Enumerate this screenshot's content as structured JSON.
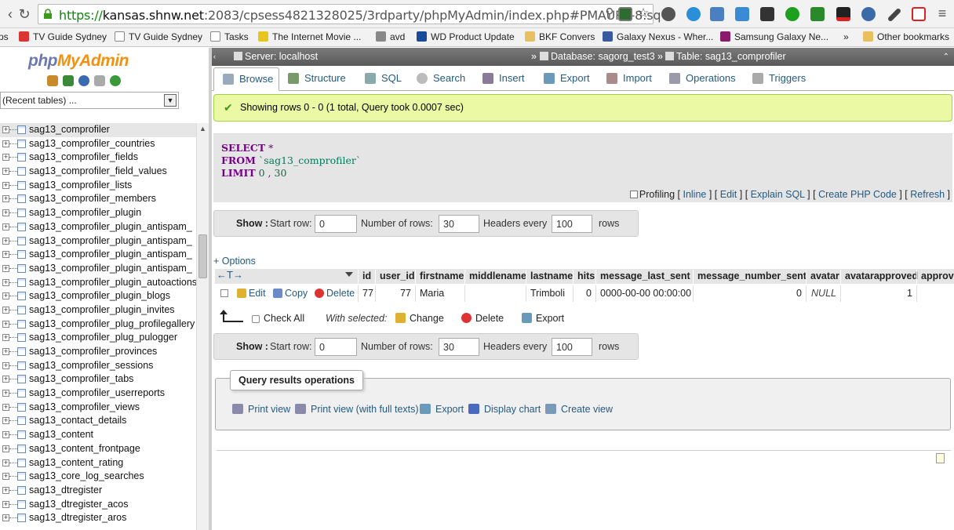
{
  "browser": {
    "url_scheme": "https://",
    "url_host": "kansas.shnw.net",
    "url_rest": ":2083/cpsess4821328025/3rdparty/phpMyAdmin/index.php#PMAURL-8:sq",
    "bookmarks": [
      {
        "label": "ps",
        "icon": "apps-icon"
      },
      {
        "label": "TV Guide Sydney",
        "icon": "tv-icon"
      },
      {
        "label": "TV Guide Sydney",
        "icon": "page-icon"
      },
      {
        "label": "Tasks",
        "icon": "page-icon"
      },
      {
        "label": "The Internet Movie ...",
        "icon": "imdb-icon"
      },
      {
        "label": "avd",
        "icon": "car-icon"
      },
      {
        "label": "WD Product Update",
        "icon": "wd-icon"
      },
      {
        "label": "BKF Convers",
        "icon": "folder-icon"
      },
      {
        "label": "Galaxy Nexus - Wher...",
        "icon": "site-icon"
      },
      {
        "label": "Samsung Galaxy Ne...",
        "icon": "m-icon"
      }
    ],
    "bookmarks_more": "»",
    "other_bookmarks": "Other bookmarks"
  },
  "nav": {
    "logo_php": "php",
    "logo_my": "My",
    "logo_admin": "Admin",
    "recent_tables": "(Recent tables) ...",
    "tables": [
      "sag13_comprofiler",
      "sag13_comprofiler_countries",
      "sag13_comprofiler_fields",
      "sag13_comprofiler_field_values",
      "sag13_comprofiler_lists",
      "sag13_comprofiler_members",
      "sag13_comprofiler_plugin",
      "sag13_comprofiler_plugin_antispam_",
      "sag13_comprofiler_plugin_antispam_",
      "sag13_comprofiler_plugin_antispam_",
      "sag13_comprofiler_plugin_antispam_",
      "sag13_comprofiler_plugin_autoactions",
      "sag13_comprofiler_plugin_blogs",
      "sag13_comprofiler_plugin_invites",
      "sag13_comprofiler_plug_profilegallery",
      "sag13_comprofiler_plug_pulogger",
      "sag13_comprofiler_provinces",
      "sag13_comprofiler_sessions",
      "sag13_comprofiler_tabs",
      "sag13_comprofiler_userreports",
      "sag13_comprofiler_views",
      "sag13_contact_details",
      "sag13_content",
      "sag13_content_frontpage",
      "sag13_content_rating",
      "sag13_core_log_searches",
      "sag13_dtregister",
      "sag13_dtregister_acos",
      "sag13_dtregister_aros"
    ]
  },
  "breadcrumb": {
    "server": "Server: localhost",
    "database": "Database: sagorg_test3",
    "table": "Table: sag13_comprofiler",
    "sep": "»"
  },
  "tabs": [
    {
      "label": "Browse",
      "active": true
    },
    {
      "label": "Structure"
    },
    {
      "label": "SQL"
    },
    {
      "label": "Search"
    },
    {
      "label": "Insert"
    },
    {
      "label": "Export"
    },
    {
      "label": "Import"
    },
    {
      "label": "Operations"
    },
    {
      "label": "Triggers"
    }
  ],
  "message": "Showing rows 0 - 0 (1 total, Query took 0.0007 sec)",
  "sql": {
    "select": "SELECT",
    "star": "*",
    "from": "FROM",
    "table": "`sag13_comprofiler`",
    "limit": "LIMIT",
    "offset": "0",
    "comma": ",",
    "count": "30"
  },
  "sql_links": {
    "profiling": "Profiling",
    "inline": "Inline",
    "edit": "Edit",
    "explain": "Explain SQL",
    "php": "Create PHP Code",
    "refresh": "Refresh"
  },
  "navigation": {
    "show": "Show :",
    "start_row_label": "Start row:",
    "start_row": "0",
    "num_rows_label": "Number of rows:",
    "num_rows": "30",
    "headers_label": "Headers every",
    "headers": "100",
    "rows_label": "rows"
  },
  "options_link": "+ Options",
  "columns": [
    "id",
    "user_id",
    "firstname",
    "middlename",
    "lastname",
    "hits",
    "message_last_sent",
    "message_number_sent",
    "avatar",
    "avatarapproved",
    "approve"
  ],
  "row": {
    "edit": "Edit",
    "copy": "Copy",
    "delete": "Delete",
    "id": "77",
    "user_id": "77",
    "firstname": "Maria",
    "middlename": "",
    "lastname": "Trimboli",
    "hits": "0",
    "message_last_sent": "0000-00-00 00:00:00",
    "message_number_sent": "0",
    "avatar": "NULL",
    "avatarapproved": "1"
  },
  "bulk": {
    "check_all": "Check All",
    "with_selected": "With selected:",
    "change": "Change",
    "delete": "Delete",
    "export": "Export"
  },
  "qro": {
    "legend": "Query results operations",
    "print_view": "Print view",
    "print_full": "Print view (with full texts)",
    "export": "Export",
    "display_chart": "Display chart",
    "create_view": "Create view"
  },
  "colors": {
    "link": "#235a81",
    "success_bg": "#ebf8a4",
    "keyword": "#770088",
    "logo_blue": "#6c78af",
    "logo_orange": "#f29111"
  }
}
